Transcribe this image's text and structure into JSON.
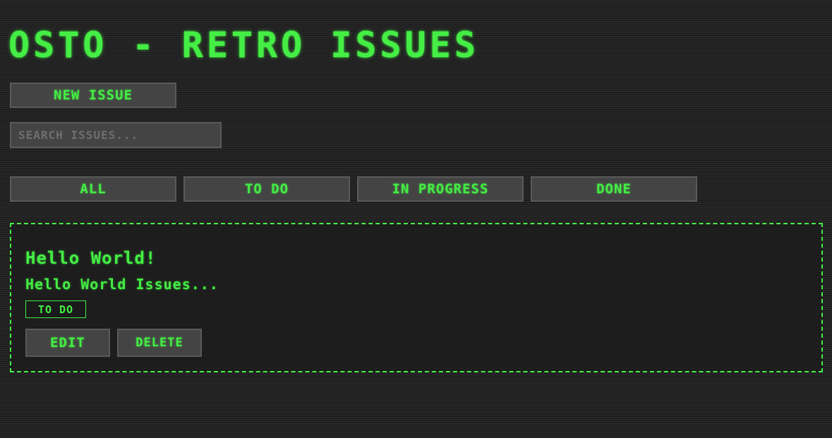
{
  "header": {
    "title": "OSTO - RETRO ISSUES"
  },
  "toolbar": {
    "new_issue_label": "NEW ISSUE"
  },
  "search": {
    "placeholder": "SEARCH ISSUES...",
    "value": ""
  },
  "filters": [
    {
      "label": "ALL"
    },
    {
      "label": "TO DO"
    },
    {
      "label": "IN PROGRESS"
    },
    {
      "label": "DONE"
    }
  ],
  "issues": [
    {
      "title": "Hello World!",
      "description": "Hello World Issues...",
      "status": "TO DO",
      "edit_label": "EDIT",
      "delete_label": "DELETE"
    }
  ],
  "colors": {
    "accent": "#44ee44",
    "background": "#222222",
    "button_bg": "#444444"
  }
}
